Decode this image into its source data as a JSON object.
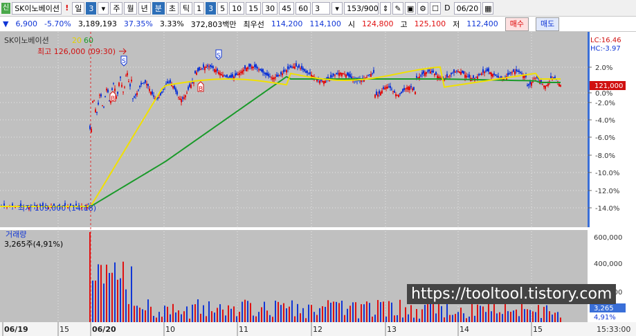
{
  "toolbar": {
    "tag": "신",
    "stock_name": "SK이노베이션",
    "exclaim": "!",
    "period_day": "일",
    "period_num": "3",
    "period_week": "주",
    "period_month": "월",
    "period_year": "년",
    "period_min": "분",
    "period_sec": "초",
    "period_tick": "틱",
    "intervals": [
      "1",
      "3",
      "5",
      "10",
      "15",
      "30",
      "45",
      "60"
    ],
    "selected_interval": "3",
    "count": "3",
    "counter": "153/900",
    "checkbox_label": "D",
    "date": "06/20"
  },
  "quote": {
    "change": "6,900",
    "change_pct": "-5.70%",
    "volume": "3,189,193",
    "ratio1": "37.35%",
    "ratio2": "3.33%",
    "amount": "372,803백만",
    "best_label": "최우선",
    "best_ask": "114,200",
    "best_bid": "114,100",
    "open_label": "시",
    "open": "124,800",
    "high_label": "고",
    "high": "125,100",
    "low_label": "저",
    "low": "112,400",
    "buy_label": "매수",
    "sell_label": "매도"
  },
  "legend": {
    "name": "SK이노베이션",
    "ma1": "20",
    "ma2": "60",
    "max_label": "최고 126,000 (09:30)",
    "min_label": "최저 109,000 (14:18)",
    "lc": "LC:16.46",
    "hc": "HC:-3.97",
    "current_price": "121,000",
    "volume_title": "거래량",
    "volume_value": "3,265주(4,91%)",
    "volume_current": "3,265",
    "volume_pct": "4,91%",
    "time": "15:33:00"
  },
  "price_axis": [
    "2.0%",
    "0.0%",
    "-2.0%",
    "-4.0%",
    "-6.0%",
    "-8.0%",
    "-10.0%",
    "-12.0%",
    "-14.0%"
  ],
  "volume_axis": [
    "600,000",
    "400,000",
    "200,000"
  ],
  "x_axis": [
    "06/19",
    "15",
    "06/20",
    "10",
    "11",
    "12",
    "13",
    "14",
    "15"
  ],
  "watermark": "https://tooltool.tistory.com",
  "colors": {
    "up": "#e01010",
    "down": "#1036d6",
    "ma20": "#f0e000",
    "ma60": "#1a9a2a",
    "bg": "#c0c0c0"
  }
}
